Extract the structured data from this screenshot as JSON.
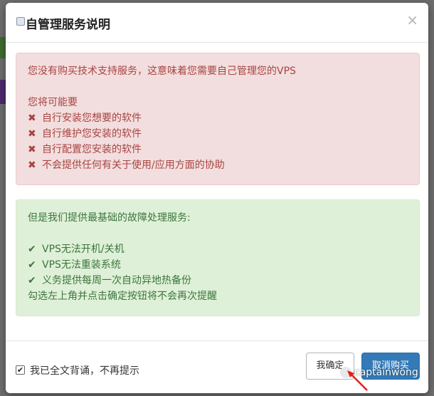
{
  "modal": {
    "title": "自管理服务说明",
    "close_glyph": "×"
  },
  "danger_alert": {
    "intro": "您没有购买技术支持服务，这意味着您需要自己管理您的VPS",
    "subheading": "您将可能要",
    "items": [
      "自行安装您想要的软件",
      "自行维护您安装的软件",
      "自行配置您安装的软件",
      "不会提供任何有关于使用/应用方面的协助"
    ],
    "icon": "x-icon",
    "color": "#a94442"
  },
  "success_alert": {
    "intro": "但是我们提供最基础的故障处理服务:",
    "items": [
      "VPS无法开机/关机",
      "VPS无法重装系统",
      "义务提供每周一次自动异地热备份"
    ],
    "note": "勾选左上角并点击确定按钮将不会再次提醒",
    "icon": "check-icon",
    "color": "#3c763d"
  },
  "footer": {
    "checkbox_label": "我已全文背诵，不再提示",
    "checkbox_checked": true,
    "confirm_label": "我确定",
    "cancel_label": "取消购买",
    "primary_color": "#337ab7"
  },
  "watermark": {
    "text": "captainwong"
  }
}
